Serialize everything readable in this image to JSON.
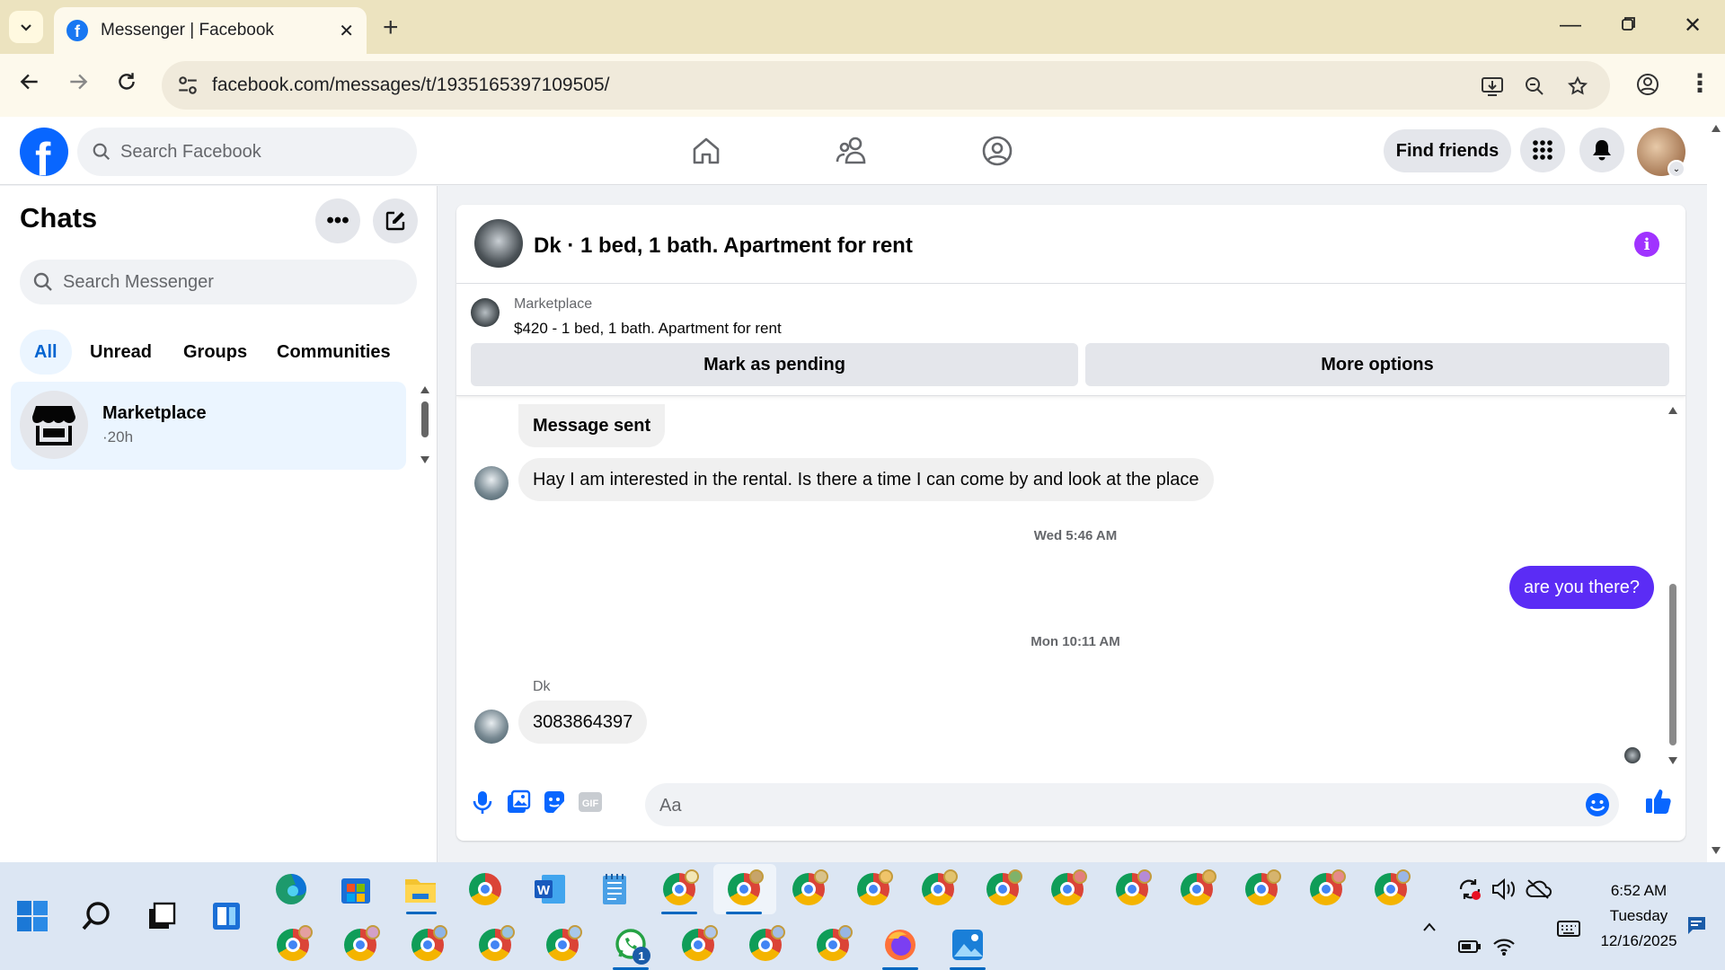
{
  "browser": {
    "tab_title": "Messenger | Facebook",
    "url": "facebook.com/messages/t/1935165397109505/"
  },
  "header": {
    "search_placeholder": "Search Facebook",
    "find_friends_label": "Find friends"
  },
  "chats": {
    "title": "Chats",
    "search_placeholder": "Search Messenger",
    "filters": [
      "All",
      "Unread",
      "Groups",
      "Communities"
    ],
    "active_filter": "All",
    "items": [
      {
        "name": "Marketplace",
        "time": "·20h"
      }
    ]
  },
  "conversation": {
    "title": "Dk · 1 bed, 1 bath. Apartment for rent",
    "listing": {
      "source": "Marketplace",
      "price_title": "$420 - 1 bed, 1 bath. Apartment for rent",
      "mark_pending_label": "Mark as pending",
      "more_options_label": "More options"
    },
    "messages": {
      "message_sent": "Message sent",
      "inquiry": "Hay I am interested in the rental. Is there a time I can come by and look at the place",
      "timestamp_1": "Wed 5:46 AM",
      "my_message": "are you there?",
      "timestamp_2": "Mon 10:11 AM",
      "sender_name": "Dk",
      "reply": "3083864397"
    },
    "composer_placeholder": "Aa"
  },
  "taskbar": {
    "time": "6:52 AM",
    "day": "Tuesday",
    "date": "12/16/2025",
    "whatsapp_badge": "1"
  },
  "colors": {
    "facebook_blue": "#0866ff",
    "my_bubble": "#5b2cf5",
    "info_purple": "#a033ff",
    "active_filter_bg": "#ebf5ff"
  }
}
